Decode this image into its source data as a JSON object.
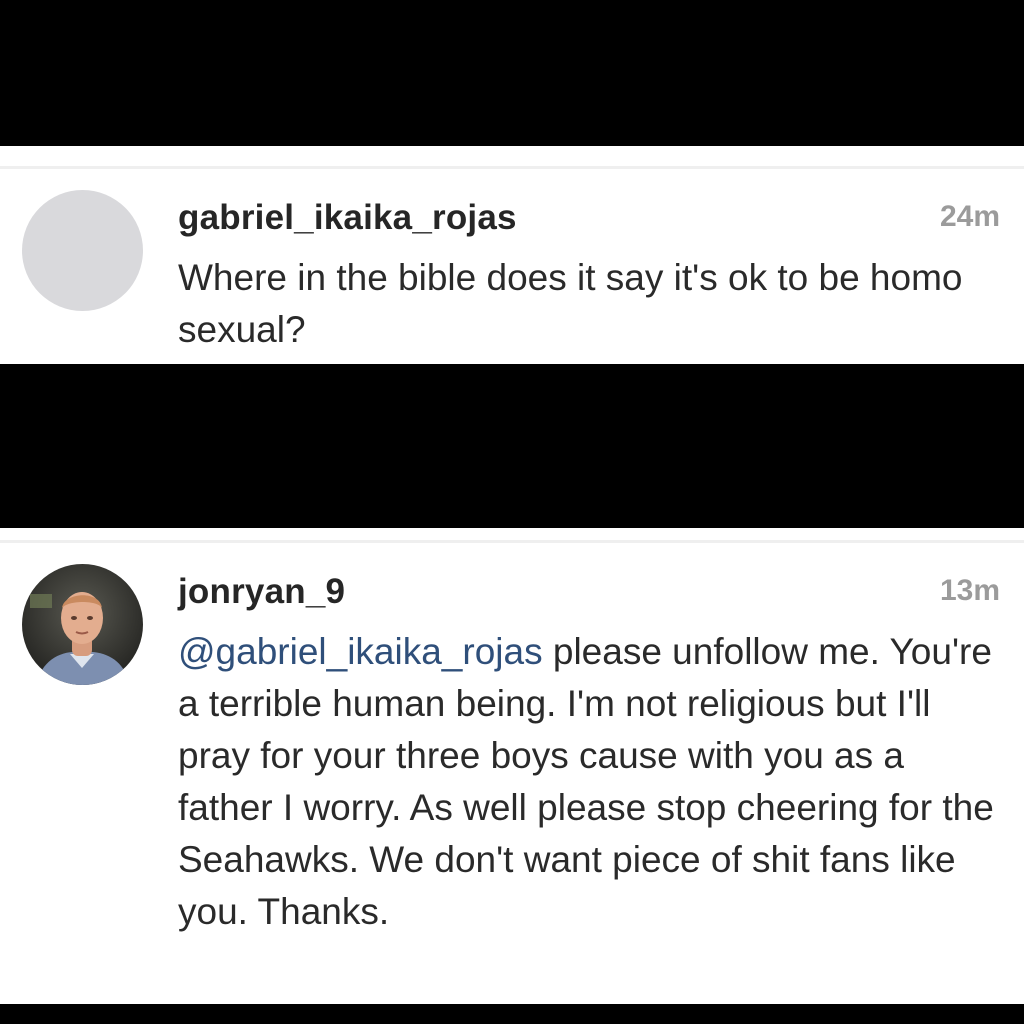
{
  "comments": [
    {
      "username": "gabriel_ikaika_rojas",
      "time": "24m",
      "text": "Where in the bible does it say it's ok to be homo sexual?",
      "avatar": "default-avatar-placeholder"
    },
    {
      "username": "jonryan_9",
      "time": "13m",
      "mention": "@gabriel_ikaika_rojas",
      "text": " please unfollow me.  You're a terrible human being. I'm not religious but I'll pray for your three boys cause with you as a father I worry. As well please stop cheering for the Seahawks. We don't want piece of shit fans like you. Thanks.",
      "avatar": "profile-photo"
    }
  ],
  "colors": {
    "background_band": "#000000",
    "card": "#ffffff",
    "username": "#262626",
    "timestamp": "#9b9b9b",
    "mention": "#2f4f7a",
    "placeholder_avatar": "#d9d9dc"
  }
}
